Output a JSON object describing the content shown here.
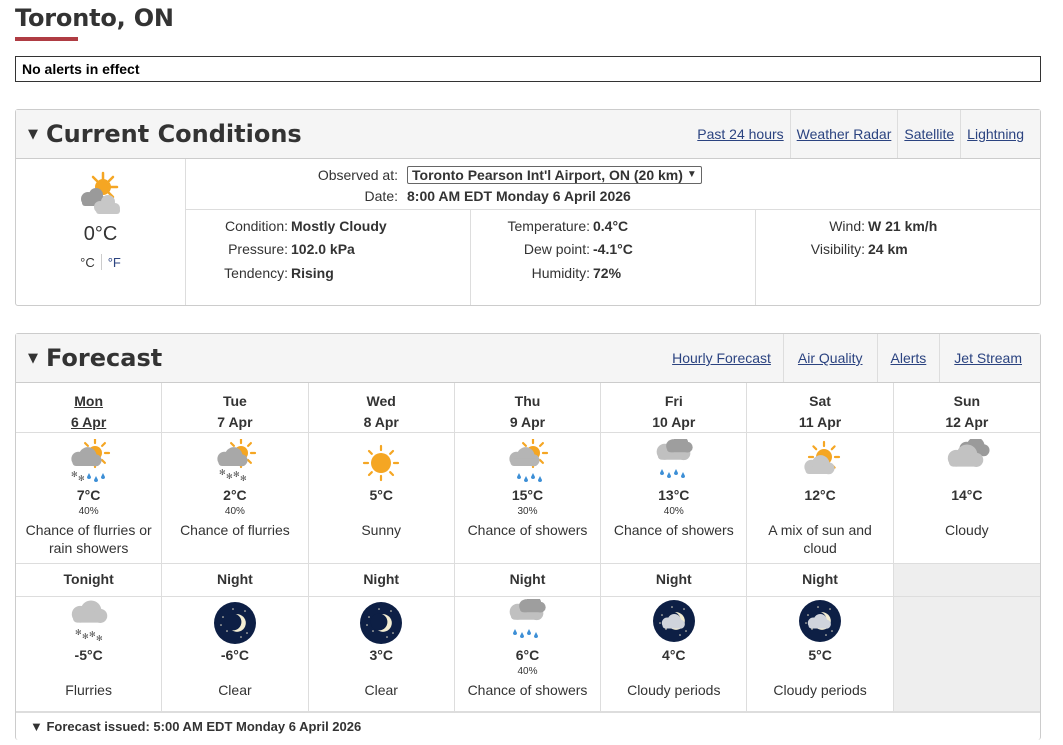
{
  "page": {
    "title": "Toronto, ON",
    "alert_text": "No alerts in effect"
  },
  "current": {
    "heading": "Current Conditions",
    "links": [
      "Past 24 hours",
      "Weather Radar",
      "Satellite",
      "Lightning"
    ],
    "icon": "sun-cloud-icon",
    "temp": "0°C",
    "unit_c": "°C",
    "unit_f": "°F",
    "observed_label": "Observed at:",
    "observed_value": "Toronto Pearson Int'l Airport, ON (20 km)",
    "date_label": "Date:",
    "date_value": "8:00 AM EDT Monday 6 April 2026",
    "condition_label": "Condition:",
    "condition": "Mostly Cloudy",
    "pressure_label": "Pressure:",
    "pressure": "102.0 kPa",
    "tendency_label": "Tendency:",
    "tendency": "Rising",
    "temperature_label": "Temperature:",
    "temperature": "0.4°C",
    "dewpoint_label": "Dew point:",
    "dewpoint": "-4.1°C",
    "humidity_label": "Humidity:",
    "humidity": "72%",
    "wind_label": "Wind:",
    "wind": "W 21 km/h",
    "visibility_label": "Visibility:",
    "visibility": "24 km"
  },
  "forecast": {
    "heading": "Forecast",
    "links": [
      "Hourly Forecast",
      "Air Quality",
      "Alerts",
      "Jet Stream"
    ],
    "days": [
      {
        "day": "Mon",
        "date": "6 Apr",
        "icon": "sun-cloud-flurries-rain-icon",
        "temp": "7°C",
        "pop": "40%",
        "summary": "Chance of flurries or rain showers"
      },
      {
        "day": "Tue",
        "date": "7 Apr",
        "icon": "sun-cloud-flurries-icon",
        "temp": "2°C",
        "pop": "40%",
        "summary": "Chance of flurries"
      },
      {
        "day": "Wed",
        "date": "8 Apr",
        "icon": "sun-icon",
        "temp": "5°C",
        "pop": "",
        "summary": "Sunny"
      },
      {
        "day": "Thu",
        "date": "9 Apr",
        "icon": "sun-cloud-showers-icon",
        "temp": "15°C",
        "pop": "30%",
        "summary": "Chance of showers"
      },
      {
        "day": "Fri",
        "date": "10 Apr",
        "icon": "cloud-showers-icon",
        "temp": "13°C",
        "pop": "40%",
        "summary": "Chance of showers"
      },
      {
        "day": "Sat",
        "date": "11 Apr",
        "icon": "sun-cloud-icon",
        "temp": "12°C",
        "pop": "",
        "summary": "A mix of sun and cloud"
      },
      {
        "day": "Sun",
        "date": "12 Apr",
        "icon": "cloud-icon",
        "temp": "14°C",
        "pop": "",
        "summary": "Cloudy"
      }
    ],
    "nights": [
      {
        "label": "Tonight",
        "icon": "cloud-flurries-icon",
        "temp": "-5°C",
        "pop": "",
        "summary": "Flurries"
      },
      {
        "label": "Night",
        "icon": "moon-clear-icon",
        "temp": "-6°C",
        "pop": "",
        "summary": "Clear"
      },
      {
        "label": "Night",
        "icon": "moon-clear-icon",
        "temp": "3°C",
        "pop": "",
        "summary": "Clear"
      },
      {
        "label": "Night",
        "icon": "cloud-showers-icon",
        "temp": "6°C",
        "pop": "40%",
        "summary": "Chance of showers"
      },
      {
        "label": "Night",
        "icon": "moon-cloud-icon",
        "temp": "4°C",
        "pop": "",
        "summary": "Cloudy periods"
      },
      {
        "label": "Night",
        "icon": "moon-cloud-icon",
        "temp": "5°C",
        "pop": "",
        "summary": "Cloudy periods"
      }
    ],
    "issued": "Forecast issued: 5:00 AM EDT Monday 6 April 2026"
  },
  "colors": {
    "accent": "#af3c43",
    "link": "#2b4380",
    "sun": "#f5a623",
    "cloud": "#b5b5b5",
    "rain": "#3d8fd6",
    "night": "#0d1f45"
  }
}
